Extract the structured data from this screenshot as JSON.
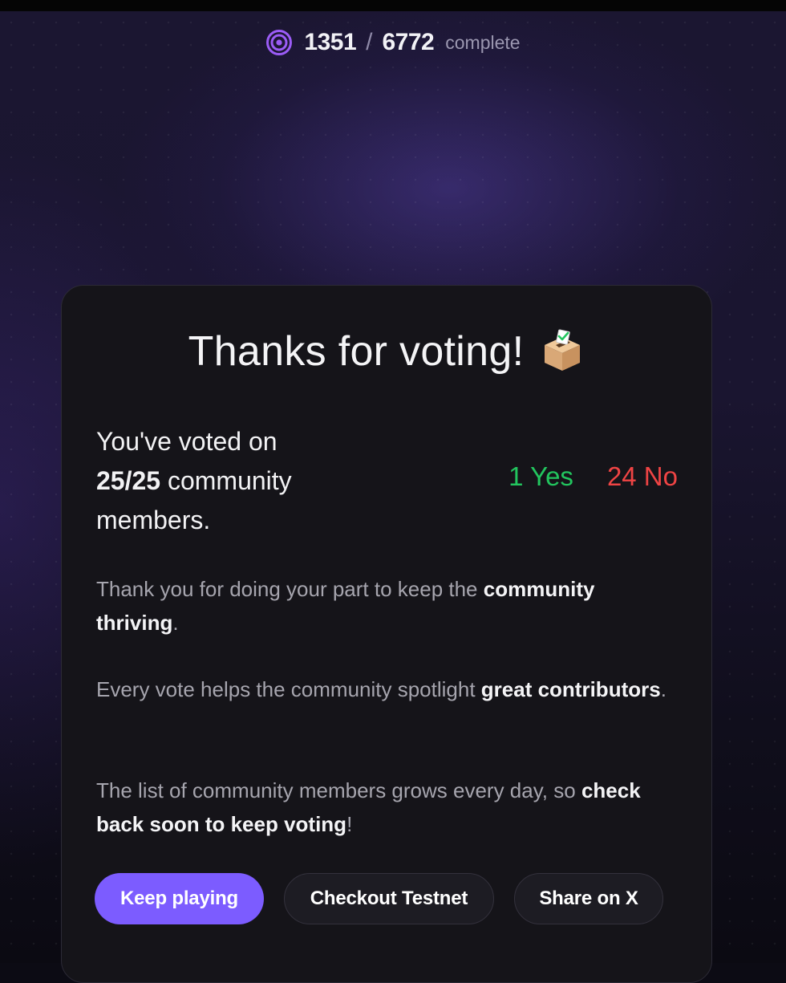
{
  "progress": {
    "completed": "1351",
    "separator": "/",
    "total": "6772",
    "label": "complete",
    "icon": "target-icon"
  },
  "card": {
    "title": "Thanks for voting!",
    "title_icon": "ballot-box-icon",
    "summary": {
      "prefix": "You've voted on",
      "count": "25/25",
      "suffix": "community members."
    },
    "tally": {
      "yes": "1 Yes",
      "no": "24 No",
      "yes_color": "#22c55e",
      "no_color": "#ef4444"
    },
    "paragraphs": [
      {
        "text": "Thank you for doing your part to keep the ",
        "highlight": "community thriving",
        "end": "."
      },
      {
        "text": "Every vote helps the community spotlight ",
        "highlight": "great contributors",
        "end": "."
      },
      {
        "text": "The list of community members grows every day, so ",
        "highlight": "check back soon to keep voting",
        "end": "!"
      }
    ],
    "buttons": {
      "keep_playing": "Keep playing",
      "checkout_testnet": "Checkout Testnet",
      "share_on_x": "Share on X"
    }
  },
  "colors": {
    "accent": "#7c5cff",
    "card_bg": "#151419",
    "page_bg": "#1a1530"
  }
}
